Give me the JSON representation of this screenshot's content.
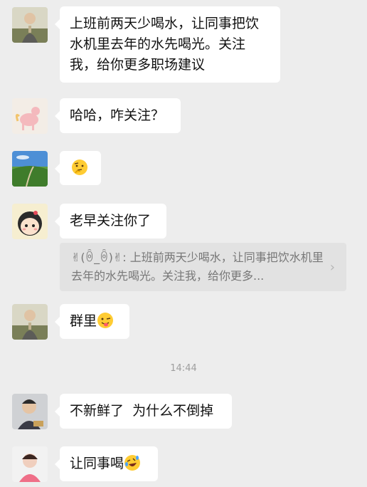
{
  "messages": [
    {
      "text": "上班前两天少喝水，让同事把饮水机里去年的水先喝光。关注我，给你更多职场建议"
    },
    {
      "text": "哈哈，咋关注？"
    },
    {
      "text": ""
    },
    {
      "text": "老早关注你了"
    },
    {
      "quote_sender": "✌(ꉺ_ꉺ)✌",
      "quote_text": ": 上班前两天少喝水，让同事把饮水机里去年的水先喝光。关注我，给你更多..."
    },
    {
      "text": "群里"
    },
    {
      "text": "不新鲜了  为什么不倒掉"
    },
    {
      "text": "让同事喝"
    }
  ],
  "timestamp": "14:44",
  "icons": {
    "thinking": "thinking-face-emoji",
    "wink": "winking-tongue-emoji",
    "laugh": "rolling-laughing-emoji",
    "quote_chevron": "chevron-right-icon"
  },
  "colors": {
    "background": "#ededed",
    "bubble": "#ffffff",
    "quote_bg": "#e2e2e2",
    "timestamp": "#9e9e9e"
  }
}
